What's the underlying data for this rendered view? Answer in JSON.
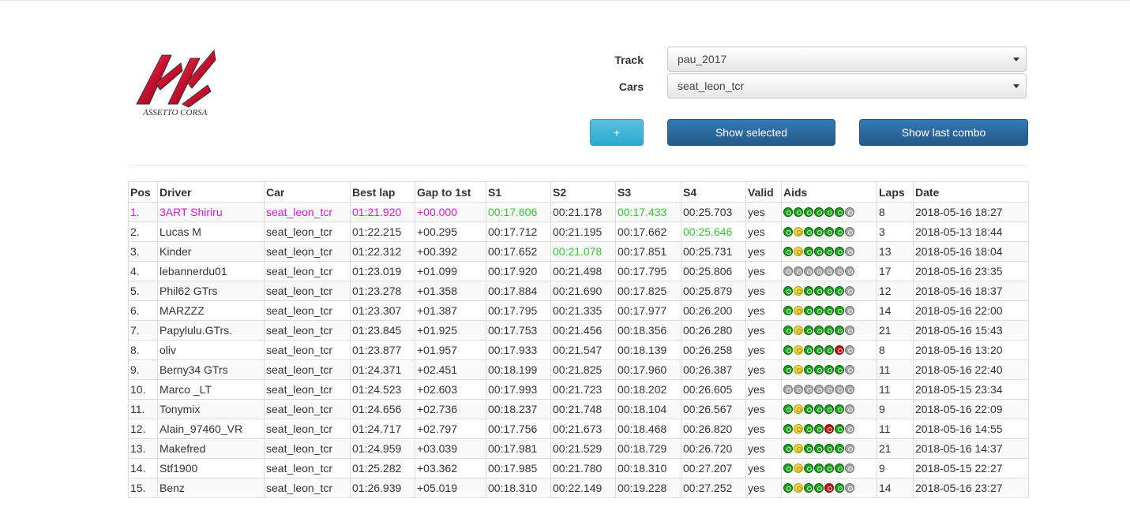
{
  "header": {
    "logo_text": "ASSETTO CORSA",
    "track_label": "Track",
    "track_value": "pau_2017",
    "cars_label": "Cars",
    "cars_value": "seat_leon_tcr",
    "add_button": "+",
    "show_selected_button": "Show selected",
    "show_last_combo_button": "Show last combo"
  },
  "table": {
    "columns": [
      "Pos",
      "Driver",
      "Car",
      "Best lap",
      "Gap to 1st",
      "S1",
      "S2",
      "S3",
      "S4",
      "Valid",
      "Aids",
      "Laps",
      "Date"
    ],
    "rows": [
      {
        "pos": "1.",
        "driver": "3ART Shiriru",
        "car": "seat_leon_tcr",
        "best": "01:21.920",
        "gap": "+00.000",
        "s1": "00:17.606",
        "s2": "00:21.178",
        "s3": "00:17.433",
        "s4": "00:25.703",
        "valid": "yes",
        "aids": "ggggggs",
        "laps": "8",
        "date": "2018-05-16 18:27",
        "highlight": true,
        "best_sector": [
          "s1",
          "s3"
        ]
      },
      {
        "pos": "2.",
        "driver": "Lucas M",
        "car": "seat_leon_tcr",
        "best": "01:22.215",
        "gap": "+00.295",
        "s1": "00:17.712",
        "s2": "00:21.195",
        "s3": "00:17.662",
        "s4": "00:25.646",
        "valid": "yes",
        "aids": "gyggggs",
        "laps": "3",
        "date": "2018-05-13 18:44",
        "best_sector": [
          "s4"
        ]
      },
      {
        "pos": "3.",
        "driver": "Kinder",
        "car": "seat_leon_tcr",
        "best": "01:22.312",
        "gap": "+00.392",
        "s1": "00:17.652",
        "s2": "00:21.078",
        "s3": "00:17.851",
        "s4": "00:25.731",
        "valid": "yes",
        "aids": "gyggggs",
        "laps": "13",
        "date": "2018-05-16 18:04",
        "best_sector": [
          "s2"
        ]
      },
      {
        "pos": "4.",
        "driver": "lebannerdu01",
        "car": "seat_leon_tcr",
        "best": "01:23.019",
        "gap": "+01.099",
        "s1": "00:17.920",
        "s2": "00:21.498",
        "s3": "00:17.795",
        "s4": "00:25.806",
        "valid": "yes",
        "aids": "sssssss",
        "laps": "17",
        "date": "2018-05-16 23:35"
      },
      {
        "pos": "5.",
        "driver": "Phil62 GTrs",
        "car": "seat_leon_tcr",
        "best": "01:23.278",
        "gap": "+01.358",
        "s1": "00:17.884",
        "s2": "00:21.690",
        "s3": "00:17.825",
        "s4": "00:25.879",
        "valid": "yes",
        "aids": "gyggggs",
        "laps": "12",
        "date": "2018-05-16 18:37"
      },
      {
        "pos": "6.",
        "driver": "MARZZZ",
        "car": "seat_leon_tcr",
        "best": "01:23.307",
        "gap": "+01.387",
        "s1": "00:17.795",
        "s2": "00:21.335",
        "s3": "00:17.977",
        "s4": "00:26.200",
        "valid": "yes",
        "aids": "gyggggs",
        "laps": "14",
        "date": "2018-05-16 22:00"
      },
      {
        "pos": "7.",
        "driver": "Papylulu.GTrs.",
        "car": "seat_leon_tcr",
        "best": "01:23.845",
        "gap": "+01.925",
        "s1": "00:17.753",
        "s2": "00:21.456",
        "s3": "00:18.356",
        "s4": "00:26.280",
        "valid": "yes",
        "aids": "gyggggs",
        "laps": "21",
        "date": "2018-05-16 15:43"
      },
      {
        "pos": "8.",
        "driver": "oliv",
        "car": "seat_leon_tcr",
        "best": "01:23.877",
        "gap": "+01.957",
        "s1": "00:17.933",
        "s2": "00:21.547",
        "s3": "00:18.139",
        "s4": "00:26.258",
        "valid": "yes",
        "aids": "gyggggrs",
        "laps": "8",
        "date": "2018-05-16 13:20"
      },
      {
        "pos": "9.",
        "driver": "Berny34 GTrs",
        "car": "seat_leon_tcr",
        "best": "01:24.371",
        "gap": "+02.451",
        "s1": "00:18.199",
        "s2": "00:21.825",
        "s3": "00:17.960",
        "s4": "00:26.387",
        "valid": "yes",
        "aids": "gyggggs",
        "laps": "11",
        "date": "2018-05-16 22:40"
      },
      {
        "pos": "10.",
        "driver": "Marco _LT",
        "car": "seat_leon_tcr",
        "best": "01:24.523",
        "gap": "+02.603",
        "s1": "00:17.993",
        "s2": "00:21.723",
        "s3": "00:18.202",
        "s4": "00:26.605",
        "valid": "yes",
        "aids": "sssssss",
        "laps": "11",
        "date": "2018-05-15 23:34"
      },
      {
        "pos": "11.",
        "driver": "Tonymix",
        "car": "seat_leon_tcr",
        "best": "01:24.656",
        "gap": "+02.736",
        "s1": "00:18.237",
        "s2": "00:21.748",
        "s3": "00:18.104",
        "s4": "00:26.567",
        "valid": "yes",
        "aids": "gyggggs",
        "laps": "9",
        "date": "2018-05-16 22:09"
      },
      {
        "pos": "12.",
        "driver": "Alain_97460_VR",
        "car": "seat_leon_tcr",
        "best": "01:24.717",
        "gap": "+02.797",
        "s1": "00:17.756",
        "s2": "00:21.673",
        "s3": "00:18.468",
        "s4": "00:26.820",
        "valid": "yes",
        "aids": "gyggrgs",
        "laps": "11",
        "date": "2018-05-16 14:55"
      },
      {
        "pos": "13.",
        "driver": "Makefred",
        "car": "seat_leon_tcr",
        "best": "01:24.959",
        "gap": "+03.039",
        "s1": "00:17.981",
        "s2": "00:21.529",
        "s3": "00:18.729",
        "s4": "00:26.720",
        "valid": "yes",
        "aids": "gyggggs",
        "laps": "21",
        "date": "2018-05-16 14:37"
      },
      {
        "pos": "14.",
        "driver": "Stf1900",
        "car": "seat_leon_tcr",
        "best": "01:25.282",
        "gap": "+03.362",
        "s1": "00:17.985",
        "s2": "00:21.780",
        "s3": "00:18.310",
        "s4": "00:27.207",
        "valid": "yes",
        "aids": "gyggggs",
        "laps": "9",
        "date": "2018-05-15 22:27"
      },
      {
        "pos": "15.",
        "driver": "Benz",
        "car": "seat_leon_tcr",
        "best": "01:26.939",
        "gap": "+05.019",
        "s1": "00:18.310",
        "s2": "00:22.149",
        "s3": "00:19.228",
        "s4": "00:27.252",
        "valid": "yes",
        "aids": "gyggrgs",
        "laps": "14",
        "date": "2018-05-16 23:27"
      }
    ]
  },
  "colors": {
    "highlight_driver": "#d21ad2",
    "best_sector": "#35c435",
    "aid_on": "#1ca51c",
    "aid_off": "#a9a9a9",
    "aid_warn": "#c41616"
  }
}
